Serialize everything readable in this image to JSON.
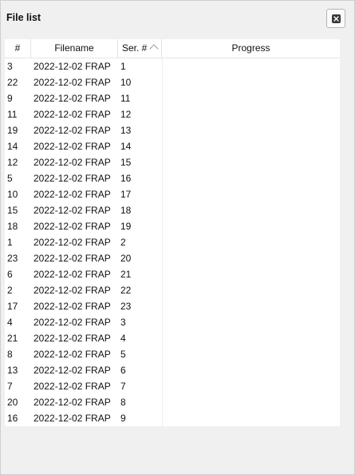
{
  "panel": {
    "title": "File list",
    "close_icon": "close-icon"
  },
  "table": {
    "columns": [
      {
        "label": "#"
      },
      {
        "label": "Filename"
      },
      {
        "label": "Ser. #"
      },
      {
        "label": "Progress"
      }
    ],
    "sort": {
      "column": "Ser. #",
      "direction": "ascending",
      "icon": "sort-ascending-icon"
    },
    "rows": [
      {
        "num": "3",
        "filename": "2022-12-02 FRAP",
        "ser": "1"
      },
      {
        "num": "22",
        "filename": "2022-12-02 FRAP",
        "ser": "10"
      },
      {
        "num": "9",
        "filename": "2022-12-02 FRAP",
        "ser": "11"
      },
      {
        "num": "11",
        "filename": "2022-12-02 FRAP",
        "ser": "12"
      },
      {
        "num": "19",
        "filename": "2022-12-02 FRAP",
        "ser": "13"
      },
      {
        "num": "14",
        "filename": "2022-12-02 FRAP",
        "ser": "14"
      },
      {
        "num": "12",
        "filename": "2022-12-02 FRAP",
        "ser": "15"
      },
      {
        "num": "5",
        "filename": "2022-12-02 FRAP",
        "ser": "16"
      },
      {
        "num": "10",
        "filename": "2022-12-02 FRAP",
        "ser": "17"
      },
      {
        "num": "15",
        "filename": "2022-12-02 FRAP",
        "ser": "18"
      },
      {
        "num": "18",
        "filename": "2022-12-02 FRAP",
        "ser": "19"
      },
      {
        "num": "1",
        "filename": "2022-12-02 FRAP",
        "ser": "2"
      },
      {
        "num": "23",
        "filename": "2022-12-02 FRAP",
        "ser": "20"
      },
      {
        "num": "6",
        "filename": "2022-12-02 FRAP",
        "ser": "21"
      },
      {
        "num": "2",
        "filename": "2022-12-02 FRAP",
        "ser": "22"
      },
      {
        "num": "17",
        "filename": "2022-12-02 FRAP",
        "ser": "23"
      },
      {
        "num": "4",
        "filename": "2022-12-02 FRAP",
        "ser": "3"
      },
      {
        "num": "21",
        "filename": "2022-12-02 FRAP",
        "ser": "4"
      },
      {
        "num": "8",
        "filename": "2022-12-02 FRAP",
        "ser": "5"
      },
      {
        "num": "13",
        "filename": "2022-12-02 FRAP",
        "ser": "6"
      },
      {
        "num": "7",
        "filename": "2022-12-02 FRAP",
        "ser": "7"
      },
      {
        "num": "20",
        "filename": "2022-12-02 FRAP",
        "ser": "8"
      },
      {
        "num": "16",
        "filename": "2022-12-02 FRAP",
        "ser": "9"
      }
    ]
  },
  "colors": {
    "background": "#f0f0f0",
    "table_background": "#ffffff",
    "text": "#111111"
  }
}
